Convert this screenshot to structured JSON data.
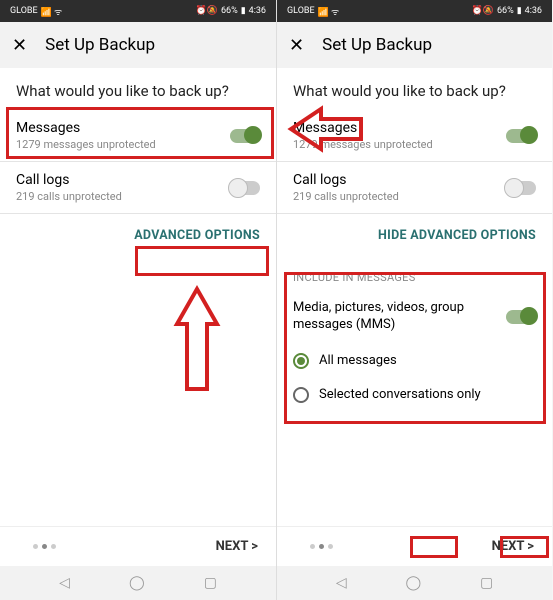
{
  "statusbar": {
    "carrier": "GLOBE",
    "battery_text": "66%",
    "time": "4:36"
  },
  "header": {
    "title": "Set Up Backup"
  },
  "content": {
    "question": "What would you like to back up?",
    "messages_label": "Messages",
    "messages_sub": "1279 messages unprotected",
    "calllogs_label": "Call logs",
    "calllogs_sub": "219 calls unprotected",
    "advanced_link": "ADVANCED OPTIONS",
    "hide_advanced_link": "HIDE ADVANCED OPTIONS"
  },
  "advanced": {
    "header": "INCLUDE IN MESSAGES",
    "media_label": "Media, pictures, videos, group messages (MMS)",
    "radio_all": "All messages",
    "radio_selected": "Selected conversations only"
  },
  "footer": {
    "next": "NEXT >"
  }
}
